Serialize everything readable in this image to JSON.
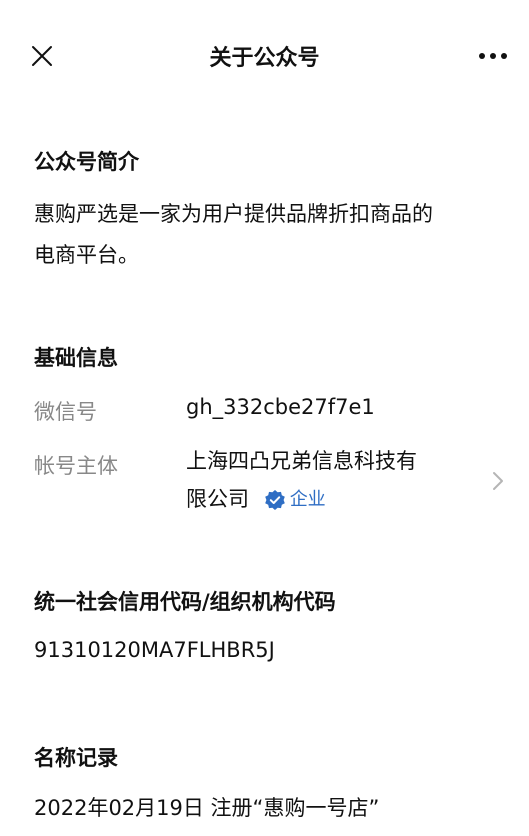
{
  "nav": {
    "title": "关于公众号"
  },
  "intro": {
    "heading": "公众号简介",
    "text_line1": "惠购严选是一家为用户提供品牌折扣商品的",
    "text_line2": "电商平台。"
  },
  "basic_info": {
    "heading": "基础信息",
    "wechat_id_label": "微信号",
    "wechat_id_value": "gh_332cbe27f7e1",
    "owner_label": "帐号主体",
    "owner_line1": "上海四凸兄弟信息科技有",
    "owner_line2": "限公司",
    "owner_badge": "企业"
  },
  "credit_code": {
    "heading": "统一社会信用代码/组织机构代码",
    "value": "91310120MA7FLHBR5J"
  },
  "name_record": {
    "heading": "名称记录",
    "entry": "2022年02月19日 注册“惠购一号店”"
  },
  "colors": {
    "label_gray": "#888888",
    "badge_blue": "#2f6ec4",
    "text": "#111111"
  },
  "icons": {
    "close": "close-icon",
    "more": "more-icon",
    "chevron": "chevron-right-icon",
    "verified": "verified-badge-icon"
  }
}
